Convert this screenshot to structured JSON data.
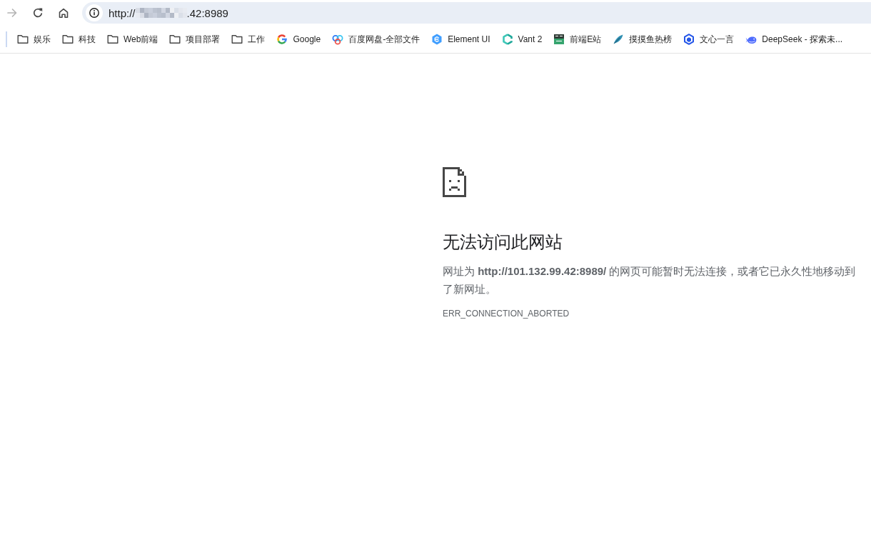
{
  "toolbar": {
    "nav_buttons": [
      {
        "kind": "forward",
        "disabled": true
      },
      {
        "kind": "reload",
        "disabled": false
      },
      {
        "kind": "home",
        "disabled": false
      }
    ],
    "address": {
      "url_start": "http://",
      "redacted": true,
      "url_end": ".42:8989"
    }
  },
  "bookmarks": [
    {
      "label": "娱乐",
      "kind": "folder"
    },
    {
      "label": "科技",
      "kind": "folder"
    },
    {
      "label": "Web前端",
      "kind": "folder"
    },
    {
      "label": "项目部署",
      "kind": "folder"
    },
    {
      "label": "工作",
      "kind": "folder"
    },
    {
      "label": "Google",
      "kind": "site"
    },
    {
      "label": "百度网盘-全部文件",
      "kind": "site"
    },
    {
      "label": "Element UI",
      "kind": "site"
    },
    {
      "label": "Vant 2",
      "kind": "site"
    },
    {
      "label": "前端E站",
      "kind": "site"
    },
    {
      "label": "摸摸鱼热榜",
      "kind": "site"
    },
    {
      "label": "文心一言",
      "kind": "site"
    },
    {
      "label": "DeepSeek - 探索未...",
      "kind": "site"
    }
  ],
  "error_page": {
    "title": "无法访问此网站",
    "message": "网址为 **http://101.132.99.42:8989/** 的网页可能暂时无法连接，或者它已永久性地移动到了新网址。",
    "code": "ERR_CONNECTION_ABORTED"
  }
}
